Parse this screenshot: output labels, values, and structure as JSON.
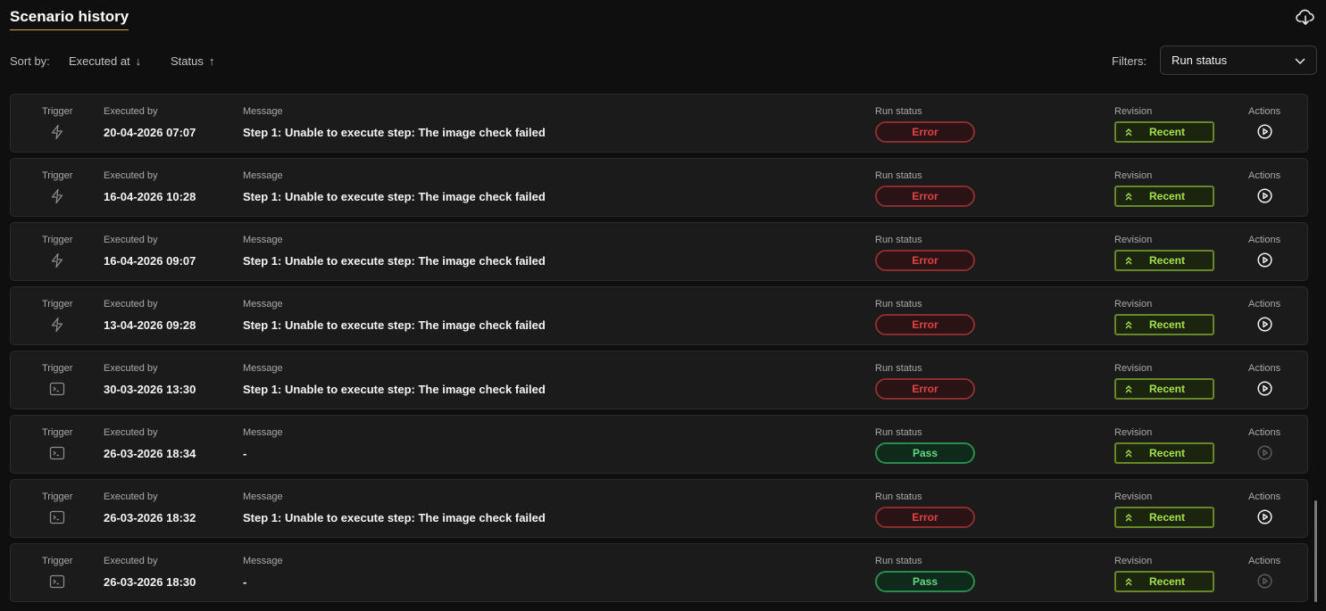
{
  "header": {
    "title": "Scenario history",
    "download_icon": "cloud-download-icon"
  },
  "sortbar": {
    "label": "Sort by:",
    "options": [
      {
        "label": "Executed at",
        "direction": "desc",
        "arrow": "↓"
      },
      {
        "label": "Status",
        "direction": "asc",
        "arrow": "↑"
      }
    ],
    "filters_label": "Filters:",
    "filter_select": {
      "value": "Run status"
    }
  },
  "columns": {
    "trigger": "Trigger",
    "executed_by": "Executed by",
    "message": "Message",
    "run_status": "Run status",
    "revision": "Revision",
    "actions": "Actions"
  },
  "colors": {
    "accent_underline": "#e0a64a",
    "error": "#e04545",
    "pass": "#5fd883",
    "recent": "#a6e24a"
  },
  "rows": [
    {
      "trigger_icon": "lightning-icon",
      "executed_at": "20-04-2026 07:07",
      "message": "Step 1: Unable to execute step: The image check failed",
      "status": "Error",
      "revision": "Recent",
      "action_enabled": true
    },
    {
      "trigger_icon": "lightning-icon",
      "executed_at": "16-04-2026 10:28",
      "message": "Step 1: Unable to execute step: The image check failed",
      "status": "Error",
      "revision": "Recent",
      "action_enabled": true
    },
    {
      "trigger_icon": "lightning-icon",
      "executed_at": "16-04-2026 09:07",
      "message": "Step 1: Unable to execute step: The image check failed",
      "status": "Error",
      "revision": "Recent",
      "action_enabled": true
    },
    {
      "trigger_icon": "lightning-icon",
      "executed_at": "13-04-2026 09:28",
      "message": "Step 1: Unable to execute step: The image check failed",
      "status": "Error",
      "revision": "Recent",
      "action_enabled": true
    },
    {
      "trigger_icon": "terminal-icon",
      "executed_at": "30-03-2026 13:30",
      "message": "Step 1: Unable to execute step: The image check failed",
      "status": "Error",
      "revision": "Recent",
      "action_enabled": true
    },
    {
      "trigger_icon": "terminal-icon",
      "executed_at": "26-03-2026 18:34",
      "message": "-",
      "status": "Pass",
      "revision": "Recent",
      "action_enabled": false
    },
    {
      "trigger_icon": "terminal-icon",
      "executed_at": "26-03-2026 18:32",
      "message": "Step 1: Unable to execute step: The image check failed",
      "status": "Error",
      "revision": "Recent",
      "action_enabled": true
    },
    {
      "trigger_icon": "terminal-icon",
      "executed_at": "26-03-2026 18:30",
      "message": "-",
      "status": "Pass",
      "revision": "Recent",
      "action_enabled": false
    }
  ]
}
